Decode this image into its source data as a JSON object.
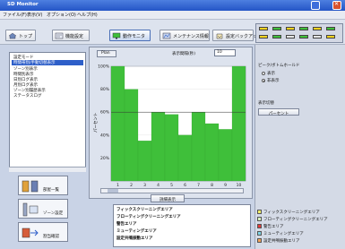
{
  "window": {
    "title": "SD Monitor"
  },
  "menu": [
    "ファイル(F)",
    "表示(V)",
    "オプション(O)",
    "ヘルプ(H)"
  ],
  "toolbar": [
    {
      "label": "トップ",
      "icon": "home-icon"
    },
    {
      "label": "機能設定",
      "icon": "settings-icon"
    },
    {
      "label": "動作モニタ",
      "icon": "monitor-icon"
    },
    {
      "label": "メンテナンス情報",
      "icon": "maintenance-icon"
    },
    {
      "label": "設定バックアップ",
      "icon": "backup-icon"
    }
  ],
  "tree": {
    "items": [
      "設定モード",
      "時間帯別/手動切替表示",
      "ゾーン別表示",
      "時間別表示",
      "日別ログ表示",
      "月別ログ表示",
      "ゾーン別履歴表示",
      "ステータスログ"
    ],
    "selected_index": 1
  },
  "thumbnails": [
    "部屋一覧",
    "ゾーン設定",
    "割当確認"
  ],
  "chart_panel": {
    "plan_button": "Plan",
    "interval_label": "表示間隔(秒)",
    "interval_value": "10",
    "detail_button": "詳細表示"
  },
  "chart_data": {
    "type": "bar",
    "categories": [
      "1",
      "2",
      "3",
      "4",
      "5",
      "6",
      "7",
      "8",
      "9",
      "10"
    ],
    "values": [
      100,
      80,
      35,
      60,
      58,
      40,
      60,
      50,
      45,
      100
    ],
    "ylabel": "パーセント",
    "ylim": [
      0,
      100
    ],
    "yticks": [
      "100%",
      "80%",
      "60%",
      "40%",
      "20%"
    ],
    "bar_color": "#3fbf3a",
    "background": "#ffffff",
    "threshold_line": 60
  },
  "zones": [
    "フィックスクリーニングエリア",
    "フローティングクリーニングエリア",
    "警告エリア",
    "ミューティングエリア",
    "設定共鳴振動エリア"
  ],
  "right_panel": {
    "mode_label": "ピーク/ボトムホールド",
    "radio_options": [
      "表示",
      "非表示"
    ],
    "radio_selected": 1,
    "display_label": "表示切替",
    "percent_button": "パーセント",
    "legend": [
      {
        "label": "フィックスクリーニングエリア",
        "color": "#f2f06a"
      },
      {
        "label": "フローティングクリーニングエリア",
        "color": "#d7f0c0"
      },
      {
        "label": "警告エリア",
        "color": "#e23b3b"
      },
      {
        "label": "ミューティングエリア",
        "color": "#7ed3e6"
      },
      {
        "label": "設定共鳴振動エリア",
        "color": "#f2a35a"
      }
    ]
  },
  "signal_colors": [
    "#f2d21f",
    "#3fbf3a",
    "#f2d21f",
    "#3fbf3a",
    "#f2d21f",
    "#3fbf3a",
    "#f2d21f",
    "#3fbf3a",
    "#e5e5e5",
    "#3fbf3a",
    "#e5e5e5",
    "#f2d21f"
  ]
}
